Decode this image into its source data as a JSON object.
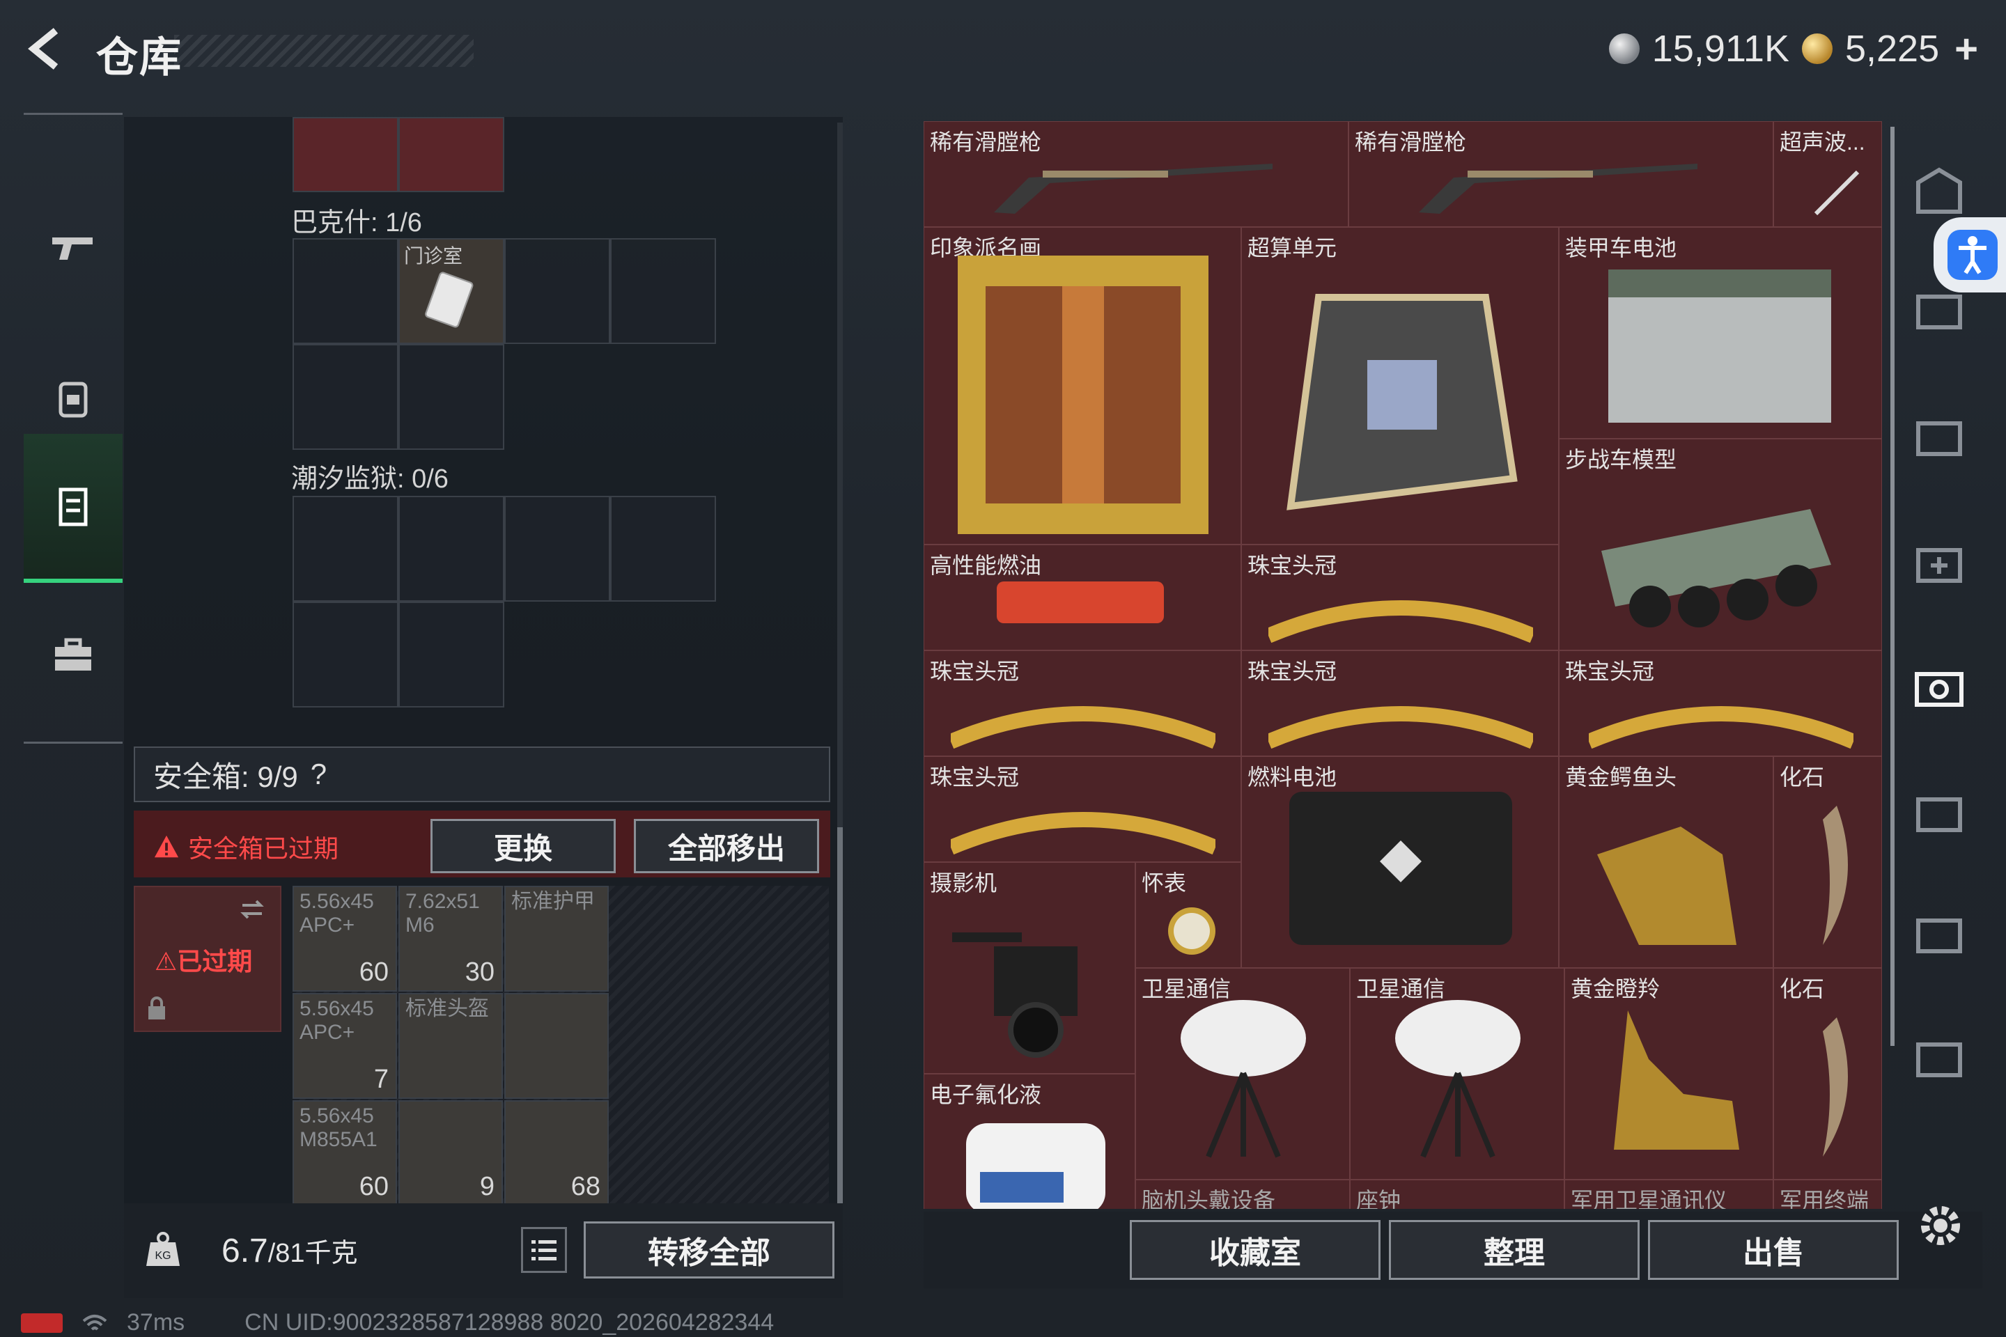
{
  "header": {
    "title": "仓库",
    "silver_amount": "15,911K",
    "gold_amount": "5,225",
    "plus": "+"
  },
  "rail": [
    "gun-icon",
    "backpack-icon",
    "container-icon",
    "briefcase-icon"
  ],
  "sections": {
    "bakesh": "巴克什: 1/6",
    "clinic": "门诊室",
    "tide_prison": "潮汐监狱: 0/6"
  },
  "safe_box": {
    "label": "安全箱: 9/9",
    "help": "?",
    "expired_warning": "安全箱已过期",
    "replace": "更换",
    "remove_all": "全部移出",
    "case_expired": "已过期"
  },
  "case_items": [
    {
      "name": "5.56x45\nAPC+",
      "qty": "60"
    },
    {
      "name": "7.62x51\nM6",
      "qty": "30"
    },
    {
      "name": "标准护甲",
      "qty": ""
    },
    {
      "name": "5.56x45\nAPC+",
      "qty": "7"
    },
    {
      "name": "标准头盔",
      "qty": ""
    },
    {
      "name": "",
      "qty": ""
    },
    {
      "name": "5.56x45\nM855A1",
      "qty": "60"
    },
    {
      "name": "",
      "qty": "9"
    },
    {
      "name": "",
      "qty": "68"
    }
  ],
  "weight": {
    "current": "6.7",
    "max": "/81千克"
  },
  "transfer_all": "转移全部",
  "stash_items": [
    "稀有滑膛枪",
    "稀有滑膛枪",
    "超声波...",
    "印象派名画",
    "超算单元",
    "装甲车电池",
    "步战车模型",
    "高性能燃油",
    "珠宝头冠",
    "珠宝头冠",
    "珠宝头冠",
    "珠宝头冠",
    "珠宝头冠",
    "燃料电池",
    "黄金鳄鱼头",
    "化石",
    "摄影机",
    "怀表",
    "卫星通信",
    "卫星通信",
    "黄金瞪羚",
    "化石",
    "电子氟化液",
    "脑机头戴设备",
    "座钟",
    "军用卫星通讯仪",
    "军用终端"
  ],
  "bottom_buttons": {
    "collection": "收藏室",
    "organize": "整理",
    "sell": "出售"
  },
  "status": {
    "ping": "37ms",
    "uid": "CN UID:9002328587128988 8020_202604282344"
  },
  "colors": {
    "accent_green": "#36d27e",
    "alert_red": "#ff4a4a",
    "item_bg": "#4c2327"
  }
}
